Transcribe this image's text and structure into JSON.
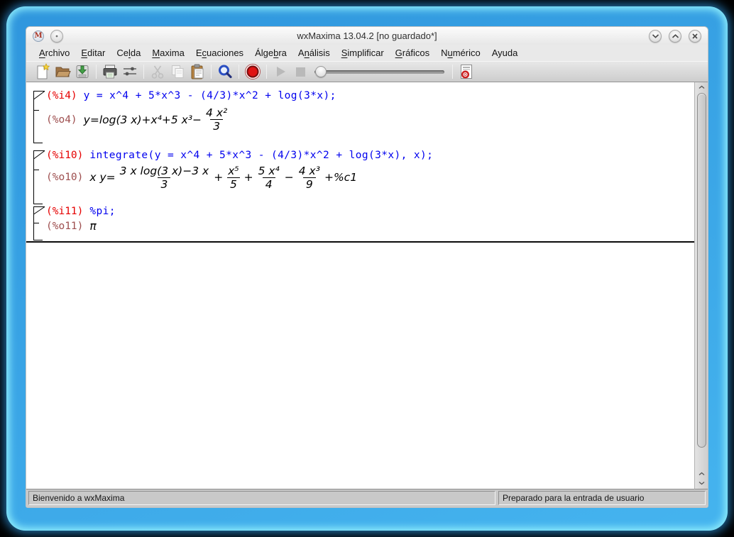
{
  "window": {
    "title": "wxMaxima 13.04.2 [no guardado*]",
    "app_icon_letter": "M",
    "buttons": {
      "minimize": "chevron-down",
      "maximize": "chevron-up",
      "close": "x"
    }
  },
  "menu": {
    "items": [
      {
        "name": "archivo",
        "pre": "",
        "key": "A",
        "post": "rchivo"
      },
      {
        "name": "editar",
        "pre": "",
        "key": "E",
        "post": "ditar"
      },
      {
        "name": "celda",
        "pre": "Ce",
        "key": "l",
        "post": "da"
      },
      {
        "name": "maxima",
        "pre": "",
        "key": "M",
        "post": "axima"
      },
      {
        "name": "ecuaciones",
        "pre": "E",
        "key": "c",
        "post": "uaciones"
      },
      {
        "name": "algebra",
        "pre": "Álge",
        "key": "b",
        "post": "ra"
      },
      {
        "name": "analisis",
        "pre": "A",
        "key": "n",
        "post": "álisis"
      },
      {
        "name": "simplificar",
        "pre": "",
        "key": "S",
        "post": "implificar"
      },
      {
        "name": "graficos",
        "pre": "",
        "key": "G",
        "post": "ráficos"
      },
      {
        "name": "numerico",
        "pre": "N",
        "key": "u",
        "post": "mérico"
      },
      {
        "name": "ayuda",
        "pre": "",
        "key": "",
        "post": "Ayuda"
      }
    ]
  },
  "toolbar": {
    "icons": [
      "new-document",
      "open-folder",
      "save",
      "print",
      "preferences",
      "cut",
      "copy",
      "paste",
      "find",
      "interrupt",
      "play",
      "stop",
      "follow-help"
    ],
    "slider_value": 0
  },
  "cells": [
    {
      "input_label": "(%i4)",
      "input_code": "y = x^4 + 5*x^3 - (4/3)*x^2 + log(3*x);",
      "output_label": "(%o4)",
      "output": {
        "lead": "y=log(3 x)+x⁴+5 x³−",
        "frac_num": "4 x²",
        "frac_den": "3"
      }
    },
    {
      "input_label": "(%i10)",
      "input_code": "integrate(y = x^4 + 5*x^3 - (4/3)*x^2 + log(3*x), x);",
      "output_label": "(%o10)",
      "output": {
        "lead": "x y=",
        "f1n": "3 x log(3 x)−3 x",
        "f1d": "3",
        "op1": "+",
        "f2n": "x⁵",
        "f2d": "5",
        "op2": "+",
        "f3n": "5 x⁴",
        "f3d": "4",
        "op3": "−",
        "f4n": "4 x³",
        "f4d": "9",
        "tail": "+%c1"
      }
    },
    {
      "input_label": "(%i11)",
      "input_code": "%pi;",
      "output_label": "(%o11)",
      "output": {
        "value": "π"
      }
    }
  ],
  "statusbar": {
    "left": "Bienvenido a wxMaxima",
    "right": "Preparado para la entrada de usuario"
  },
  "colors": {
    "frame_glow": "#45b4ef",
    "input_label": "#e60000",
    "output_label": "#9e4f4f",
    "input_code": "#0000ee",
    "find_icon_blue": "#2b4fc2",
    "interrupt_red": "#e01313"
  }
}
